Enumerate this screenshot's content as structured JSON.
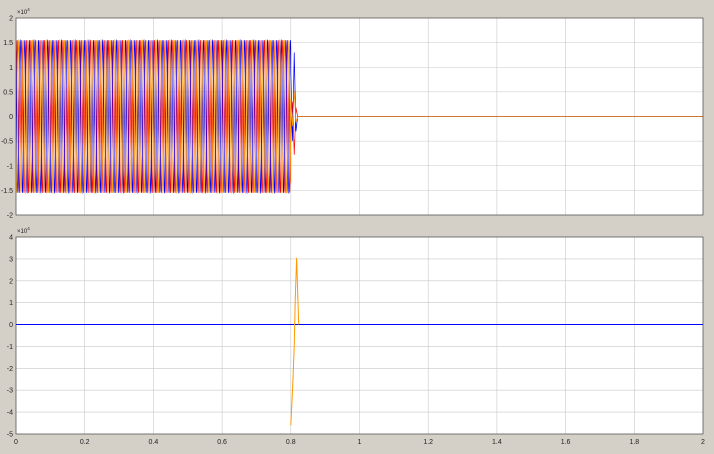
{
  "chart_data": [
    {
      "type": "line",
      "title": "",
      "xlabel": "",
      "ylabel": "",
      "xlim": [
        0,
        2
      ],
      "ylim": [
        -2,
        2
      ],
      "y_multiplier": "×10^4",
      "xticks": [
        0,
        0.2,
        0.4,
        0.6,
        0.8,
        1,
        1.2,
        1.4,
        1.6,
        1.8,
        2
      ],
      "yticks": [
        -2,
        -1.5,
        -1,
        -0.5,
        0,
        0.5,
        1,
        1.5,
        2
      ],
      "ytick_labels": [
        "-2",
        "-1.5",
        "-1",
        "-0.5",
        "0",
        "0.5",
        "1",
        "1.5",
        "2"
      ],
      "xtick_labels": [],
      "grid": true,
      "series": [
        {
          "color": "#ff0000",
          "description": "sinusoid, amplitude 1.55 until t=0.8 then ~0",
          "amplitude": 1.55,
          "cutoff": 0.8,
          "cycles": 60,
          "phase": 0
        },
        {
          "color": "#0000ff",
          "description": "sinusoid, amplitude 1.55 until t=0.8 then ~0",
          "amplitude": 1.55,
          "cutoff": 0.8,
          "cycles": 60,
          "phase": 2.094
        },
        {
          "color": "#ff9900",
          "description": "sinusoid, amplitude 1.55 until t=0.8 then ~0",
          "amplitude": 1.55,
          "cutoff": 0.8,
          "cycles": 60,
          "phase": 4.189
        }
      ],
      "transient": {
        "x": [
          0.8,
          0.805,
          0.81,
          0.815,
          0.82
        ],
        "y": [
          0.9,
          -0.5,
          1.3,
          -0.3,
          0
        ]
      }
    },
    {
      "type": "line",
      "title": "",
      "xlabel": "",
      "ylabel": "",
      "xlim": [
        0,
        2
      ],
      "ylim": [
        -5,
        4
      ],
      "y_multiplier": "×10^4",
      "xticks": [
        0,
        0.2,
        0.4,
        0.6,
        0.8,
        1,
        1.2,
        1.4,
        1.6,
        1.8,
        2
      ],
      "xtick_labels": [
        "0",
        "0.2",
        "0.4",
        "0.6",
        "0.8",
        "1",
        "1.2",
        "1.4",
        "1.6",
        "1.8",
        "2"
      ],
      "yticks": [
        -5,
        -4,
        -3,
        -2,
        -1,
        0,
        1,
        2,
        3,
        4
      ],
      "ytick_labels": [
        "-5",
        "-4",
        "-3",
        "-2",
        "-1",
        "0",
        "1",
        "2",
        "3",
        "4"
      ],
      "grid": true,
      "series": [
        {
          "color": "#0000ff",
          "x": [
            0,
            2
          ],
          "y": [
            0,
            0
          ]
        },
        {
          "color": "#ff9900",
          "x": [
            0.8,
            0.805,
            0.81,
            0.813,
            0.817,
            0.82,
            0.823
          ],
          "y": [
            -4.6,
            -3.0,
            -1.0,
            1.2,
            3.05,
            1.5,
            0
          ]
        }
      ]
    }
  ]
}
